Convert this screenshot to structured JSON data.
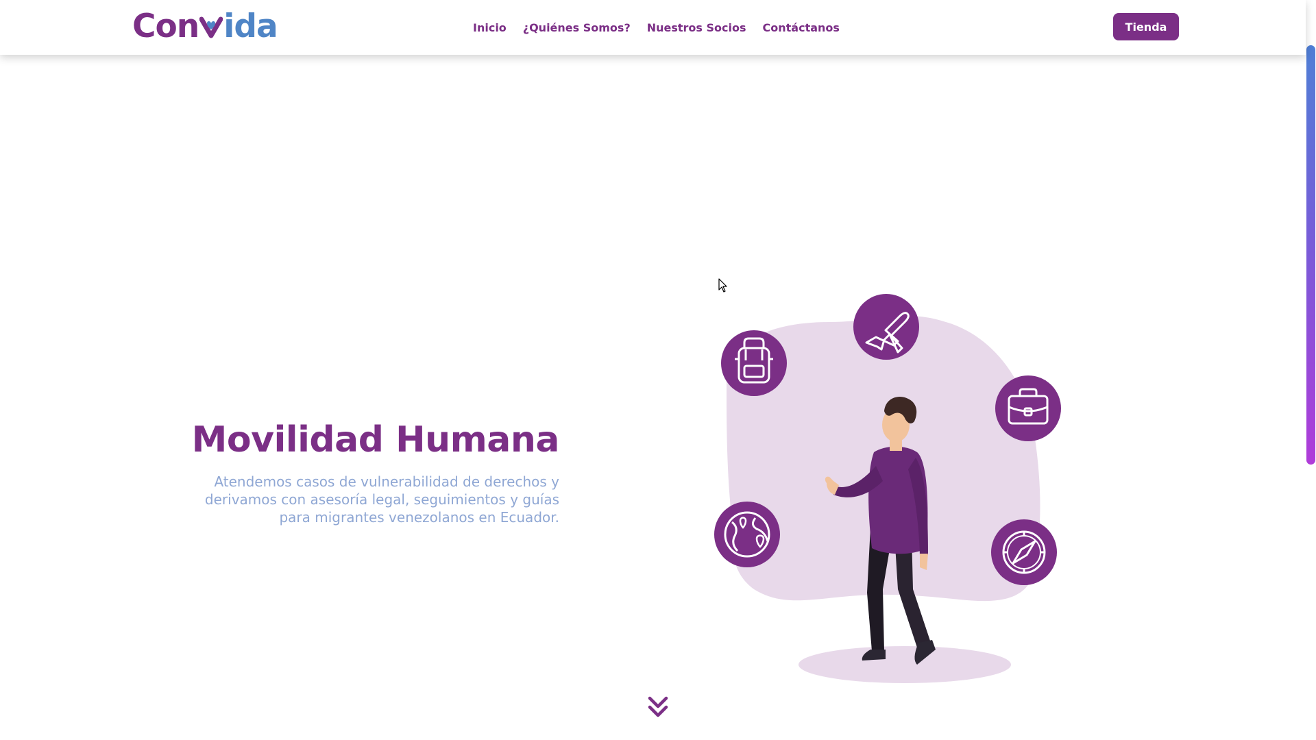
{
  "header": {
    "logo_text": "Convida",
    "nav": [
      {
        "label": "Inicio"
      },
      {
        "label": "¿Quiénes Somos?"
      },
      {
        "label": "Nuestros Socios"
      },
      {
        "label": "Contáctanos"
      }
    ],
    "shop_button": "Tienda"
  },
  "hero": {
    "title": "Movilidad Humana",
    "description": "Atendemos casos de vulnerabilidad de derechos y derivamos con asesoría legal, seguimientos y guías para migrantes venezolanos en Ecuador.",
    "icons": [
      "backpack-icon",
      "airplane-icon",
      "briefcase-icon",
      "globe-pin-icon",
      "compass-icon"
    ],
    "scroll_indicator_icon": "chevron-double-down-icon"
  },
  "colors": {
    "brand_purple": "#7b2f86",
    "brand_blue": "#4f85c6",
    "text_light_blue": "#8fa7d4",
    "blob_lilac": "#e8d9ea"
  }
}
